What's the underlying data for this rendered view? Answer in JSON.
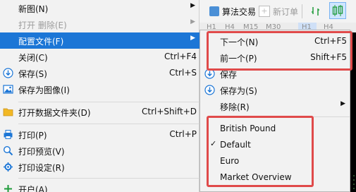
{
  "toolbar": {
    "algo_trading": "算法交易",
    "new_order": "新订单",
    "new_order_icon": "plus-icon"
  },
  "timeframes": [
    "H1",
    "H4",
    "M15",
    "M30",
    "H1",
    "H4"
  ],
  "main_menu": {
    "items": [
      {
        "label": "新图(N)",
        "shortcut": "",
        "submenu": true,
        "disabled": false,
        "icon": ""
      },
      {
        "label": "打开 删除(E)",
        "shortcut": "",
        "submenu": true,
        "disabled": true,
        "icon": ""
      },
      {
        "label": "配置文件(F)",
        "shortcut": "",
        "submenu": true,
        "active": true,
        "icon": ""
      },
      {
        "label": "关闭(C)",
        "shortcut": "Ctrl+F4",
        "icon": ""
      },
      {
        "label": "保存(S)",
        "shortcut": "Ctrl+S",
        "icon": "save-icon"
      },
      {
        "label": "保存为图像(I)",
        "shortcut": "",
        "icon": "image-icon"
      },
      {
        "label": "打开数据文件夹(D)",
        "shortcut": "Ctrl+Shift+D",
        "icon": "folder-icon"
      },
      {
        "label": "打印(P)",
        "shortcut": "Ctrl+P",
        "icon": "print-icon"
      },
      {
        "label": "打印预览(V)",
        "shortcut": "",
        "icon": "print-preview-icon"
      },
      {
        "label": "打印设定(R)",
        "shortcut": "",
        "icon": "print-settings-icon"
      },
      {
        "label": "开户(A)",
        "shortcut": "",
        "icon": "add-account-icon"
      }
    ]
  },
  "sub_menu": {
    "items": [
      {
        "label": "下一个(N)",
        "shortcut": "Ctrl+F5"
      },
      {
        "label": "前一个(P)",
        "shortcut": "Shift+F5"
      },
      {
        "label": "保存",
        "shortcut": "",
        "icon": "save-icon"
      },
      {
        "label": "保存为(S)",
        "shortcut": "",
        "icon": "save-as-icon"
      },
      {
        "label": "移除(R)",
        "shortcut": "",
        "submenu": true
      },
      {
        "label": "British Pound",
        "checked": false
      },
      {
        "label": "Default",
        "checked": true
      },
      {
        "label": "Euro",
        "checked": false
      },
      {
        "label": "Market Overview",
        "checked": false
      }
    ]
  },
  "colors": {
    "accent": "#1c76d6",
    "highlight_box": "#e04a4a",
    "menu_bg": "#f2f2f2",
    "chart_bg": "#000000"
  }
}
